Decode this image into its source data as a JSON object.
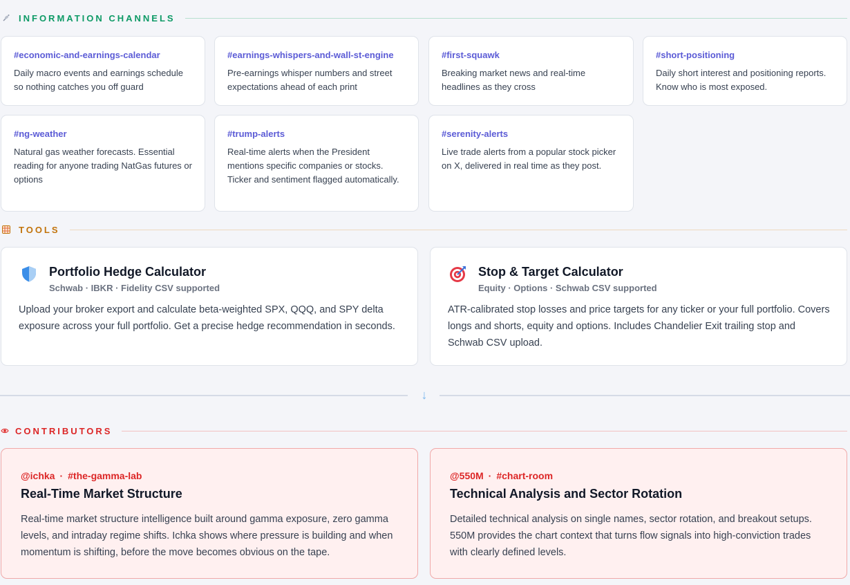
{
  "sections": {
    "channels": {
      "title": "INFORMATION CHANNELS",
      "icon": "satellite-dish-icon",
      "color": "#0e9a66"
    },
    "tools": {
      "title": "TOOLS",
      "icon": "spreadsheet-icon",
      "color": "#c2740c"
    },
    "contributors": {
      "title": "CONTRIBUTORS",
      "icon": "eye-icon",
      "color": "#dc2626"
    }
  },
  "channels": [
    {
      "name": "#economic-and-earnings-calendar",
      "desc": "Daily macro events and earnings schedule so nothing catches you off guard"
    },
    {
      "name": "#earnings-whispers-and-wall-st-engine",
      "desc": "Pre-earnings whisper numbers and street expectations ahead of each print"
    },
    {
      "name": "#first-squawk",
      "desc": "Breaking market news and real-time headlines as they cross"
    },
    {
      "name": "#short-positioning",
      "desc": "Daily short interest and positioning reports. Know who is most exposed."
    },
    {
      "name": "#ng-weather",
      "desc": "Natural gas weather forecasts. Essential reading for anyone trading NatGas futures or options"
    },
    {
      "name": "#trump-alerts",
      "desc": "Real-time alerts when the President mentions specific companies or stocks. Ticker and sentiment flagged automatically."
    },
    {
      "name": "#serenity-alerts",
      "desc": "Live trade alerts from a popular stock picker on X, delivered in real time as they post."
    }
  ],
  "tools": [
    {
      "icon": "shield-icon",
      "title": "Portfolio Hedge Calculator",
      "subtitle": "Schwab · IBKR · Fidelity CSV supported",
      "desc": "Upload your broker export and calculate beta-weighted SPX, QQQ, and SPY delta exposure across your full portfolio. Get a precise hedge recommendation in seconds."
    },
    {
      "icon": "target-icon",
      "title": "Stop & Target Calculator",
      "subtitle": "Equity · Options · Schwab CSV supported",
      "desc": "ATR-calibrated stop losses and price targets for any ticker or your full portfolio. Covers longs and shorts, equity and options. Includes Chandelier Exit trailing stop and Schwab CSV upload."
    }
  ],
  "divider": {
    "arrow": "↓"
  },
  "contributors": [
    {
      "handle": "@ichka",
      "separator": "·",
      "channel": "#the-gamma-lab",
      "title": "Real-Time Market Structure",
      "desc": "Real-time market structure intelligence built around gamma exposure, zero gamma levels, and intraday regime shifts. Ichka shows where pressure is building and when momentum is shifting, before the move becomes obvious on the tape."
    },
    {
      "handle": "@550M",
      "separator": "·",
      "channel": "#chart-room",
      "title": "Technical Analysis and Sector Rotation",
      "desc": "Detailed technical analysis on single names, sector rotation, and breakout setups. 550M provides the chart context that turns flow signals into high-conviction trades with clearly defined levels."
    }
  ]
}
